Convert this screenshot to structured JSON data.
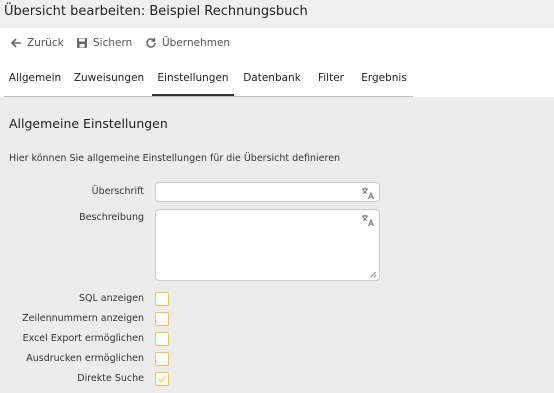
{
  "window": {
    "title": "Übersicht bearbeiten: Beispiel Rechnungsbuch"
  },
  "toolbar": {
    "back_label": "Zurück",
    "save_label": "Sichern",
    "apply_label": "Übernehmen"
  },
  "tabs": [
    {
      "label": "Allgemein",
      "active": false
    },
    {
      "label": "Zuweisungen",
      "active": false
    },
    {
      "label": "Einstellungen",
      "active": true
    },
    {
      "label": "Datenbank",
      "active": false
    },
    {
      "label": "Filter",
      "active": false
    },
    {
      "label": "Ergebnis",
      "active": false
    }
  ],
  "section": {
    "title": "Allgemeine Einstellungen",
    "description": "Hier können Sie allgemeine Einstellungen für die Übersicht definieren"
  },
  "form": {
    "heading_label": "Überschrift",
    "heading_value": "",
    "description_label": "Beschreibung",
    "description_value": "",
    "checkboxes": [
      {
        "label": "SQL anzeigen",
        "checked": false
      },
      {
        "label": "Zeilennummern anzeigen",
        "checked": false
      },
      {
        "label": "Excel Export ermöglichen",
        "checked": false
      },
      {
        "label": "Ausdrucken ermöglichen",
        "checked": false
      },
      {
        "label": "Direkte Suche",
        "checked": true
      }
    ]
  },
  "colors": {
    "checkbox_border": "#f0c24b",
    "active_tab_underline": "#333333",
    "panel_background": "#ececec"
  }
}
